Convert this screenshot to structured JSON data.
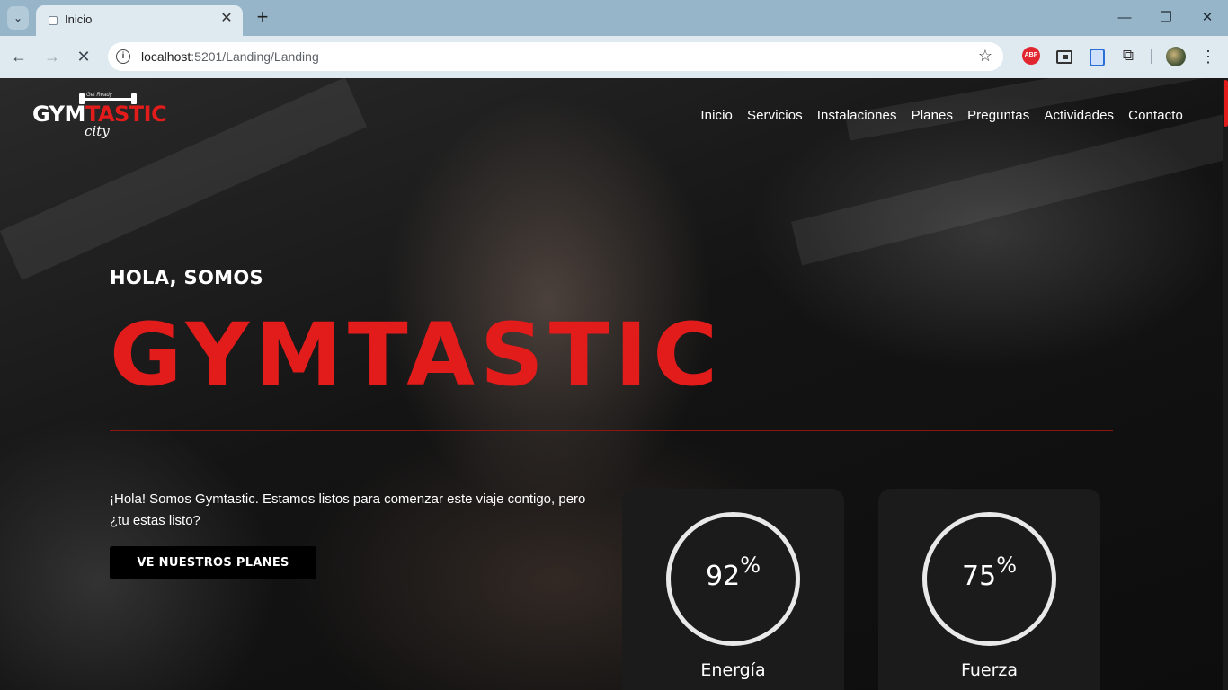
{
  "browser": {
    "tab_title": "Inicio",
    "url_host": "localhost",
    "url_rest": ":5201/Landing/Landing",
    "extensions": [
      "adblock-plus-icon",
      "picture-in-picture-icon",
      "copy-icon",
      "extensions-icon"
    ],
    "abp_label": "ABP"
  },
  "site": {
    "logo": {
      "word_white": "GYM",
      "word_red": "TASTIC",
      "script": "city",
      "tagline": "Get Ready"
    },
    "nav": [
      "Inicio",
      "Servicios",
      "Instalaciones",
      "Planes",
      "Preguntas",
      "Actividades",
      "Contacto"
    ],
    "hero": {
      "greeting": "HOLA, SOMOS",
      "title": "GYMTASTIC",
      "intro": "¡Hola! Somos Gymtastic. Estamos listos para comenzar este viaje contigo, pero ¿tu estas listo?",
      "cta": "VE NUESTROS PLANES"
    },
    "stats": [
      {
        "value": "92",
        "unit": "%",
        "label": "Energía",
        "percent": 92,
        "color": "#e21b1b"
      },
      {
        "value": "75",
        "unit": "%",
        "label": "Fuerza",
        "percent": 75,
        "color": "#7f858c"
      }
    ],
    "colors": {
      "accent": "#e21b1b",
      "track": "#e9e9e9"
    }
  }
}
